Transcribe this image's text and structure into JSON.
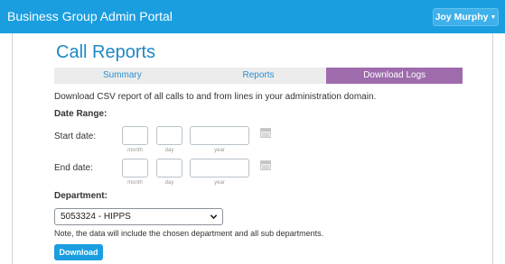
{
  "header": {
    "app_title": "Business Group Admin Portal",
    "user_name": "Joy Murphy"
  },
  "page": {
    "title": "Call Reports"
  },
  "tabs": [
    {
      "label": "Summary",
      "active": false
    },
    {
      "label": "Reports",
      "active": false
    },
    {
      "label": "Download Logs",
      "active": true
    }
  ],
  "description": "Download CSV report of all calls to and from lines in your administration domain.",
  "date_range": {
    "heading": "Date Range:",
    "start_label": "Start date:",
    "end_label": "End date:",
    "month_hint": "month",
    "day_hint": "day",
    "year_hint": "year",
    "start": {
      "month": "",
      "day": "",
      "year": ""
    },
    "end": {
      "month": "",
      "day": "",
      "year": ""
    }
  },
  "department": {
    "heading": "Department:",
    "selected": "5053324 - HIPPS",
    "note": "Note, the data will include the chosen department and all sub departments."
  },
  "actions": {
    "download_label": "Download"
  },
  "colors": {
    "brand": "#1a9ee0",
    "active_tab": "#9e6cad",
    "title": "#1f87c6"
  }
}
